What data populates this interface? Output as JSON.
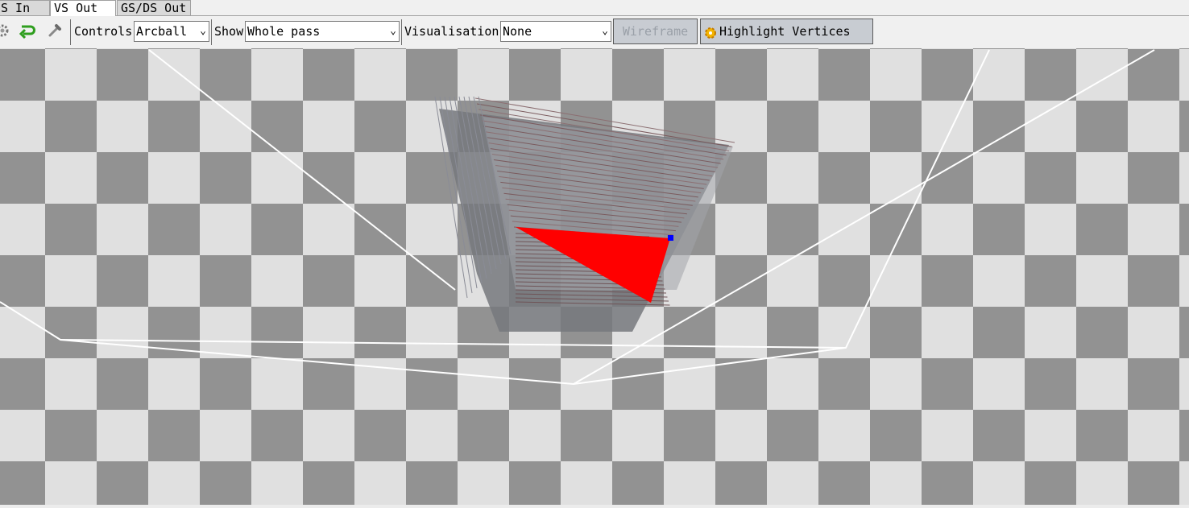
{
  "tabs": [
    {
      "label": "S In",
      "active": false
    },
    {
      "label": "VS Out",
      "active": true
    },
    {
      "label": "GS/DS Out",
      "active": false
    }
  ],
  "toolbar": {
    "icons": [
      "gear-icon",
      "reset-arrow-icon",
      "pipette-icon"
    ],
    "controls_label": "Controls",
    "controls_value": "Arcball",
    "show_label": "Show",
    "show_value": "Whole pass",
    "visualisation_label": "Visualisation",
    "visualisation_value": "None",
    "wireframe_label": "Wireframe",
    "highlight_label": "Highlight Vertices"
  },
  "colors": {
    "checker_dark": "#929292",
    "checker_light": "#e0e0e0",
    "highlight_triangle": "#ff0000",
    "selected_vertex": "#0000ff",
    "frustum_lines": "#ffffff"
  }
}
